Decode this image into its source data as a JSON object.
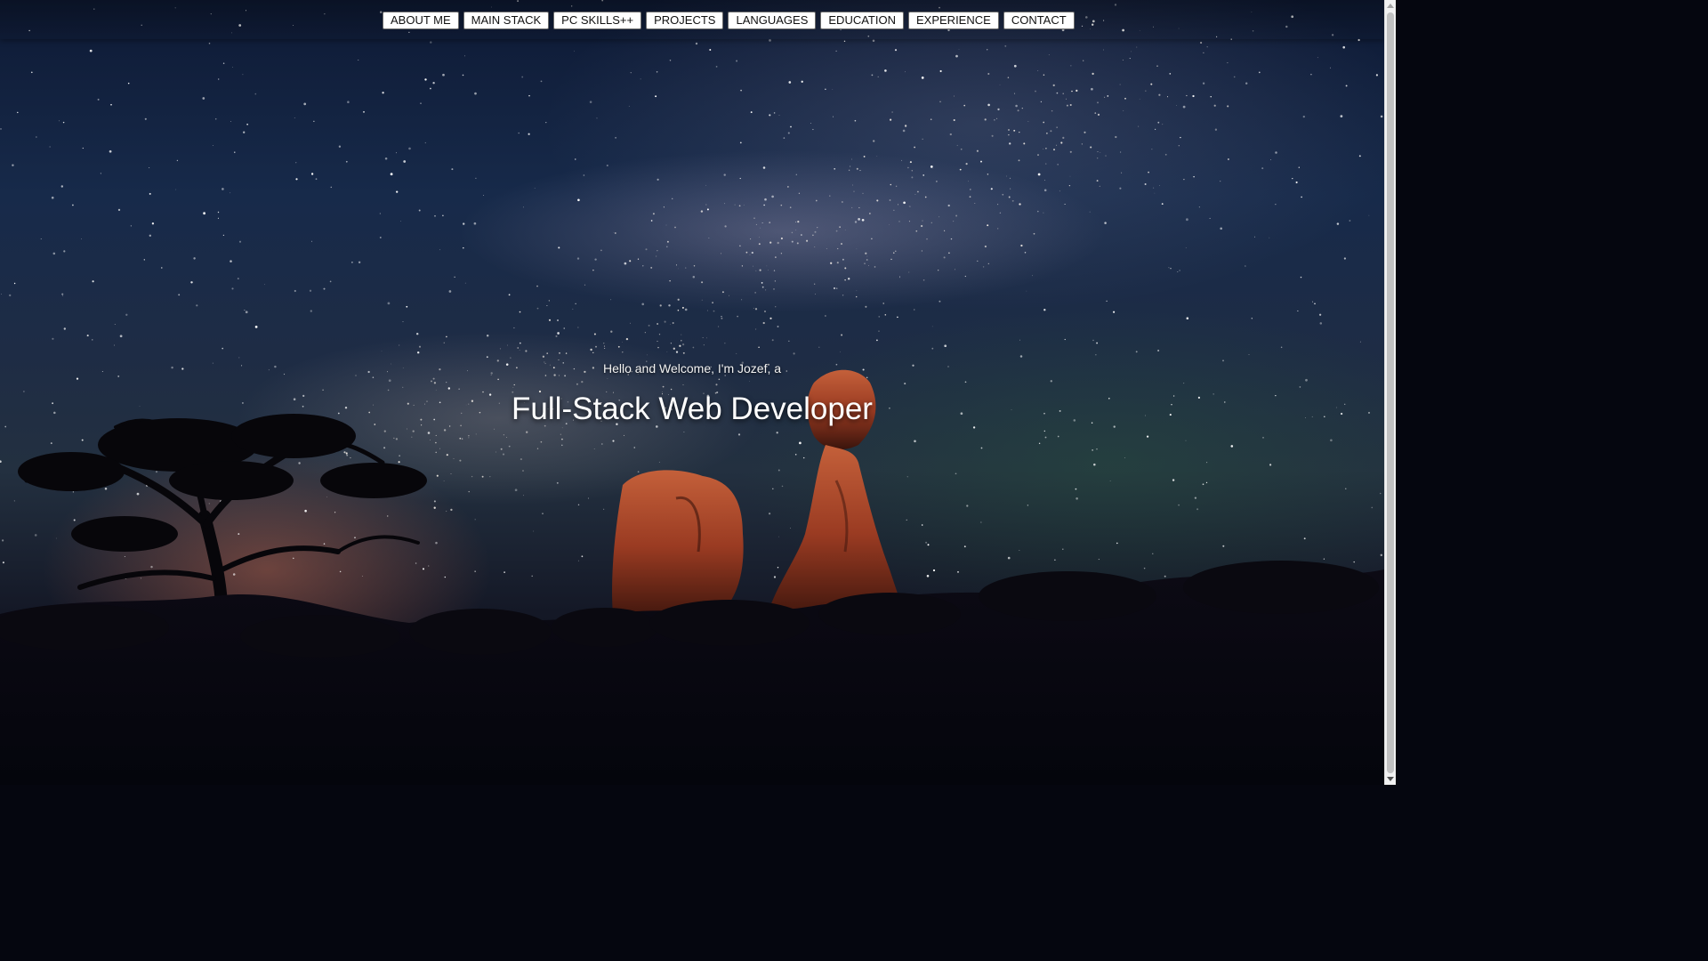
{
  "nav": {
    "items": [
      {
        "label": "ABOUT ME"
      },
      {
        "label": "MAIN STACK"
      },
      {
        "label": "PC SKILLS++"
      },
      {
        "label": "PROJECTS"
      },
      {
        "label": "LANGUAGES"
      },
      {
        "label": "EDUCATION"
      },
      {
        "label": "EXPERIENCE"
      },
      {
        "label": "CONTACT"
      }
    ]
  },
  "hero": {
    "greeting": "Hello and Welcome, I'm Jozef, a",
    "title": "Full-Stack Web Developer"
  },
  "background": {
    "description_icon": "night-sky-milky-way-balanced-rock",
    "sky_color": "#172a4a",
    "rock_color": "#a8442a"
  }
}
